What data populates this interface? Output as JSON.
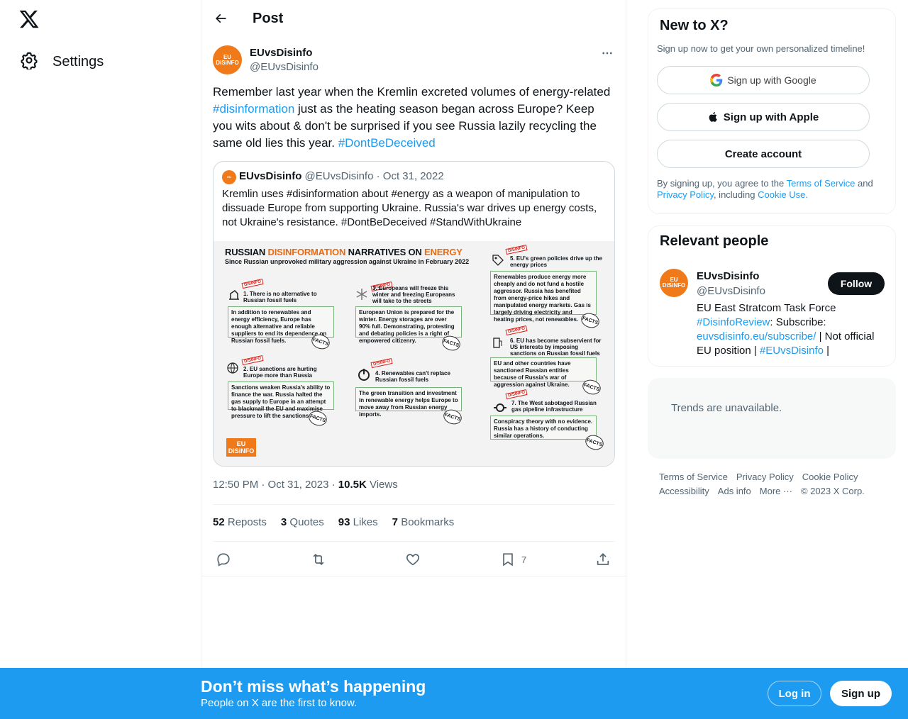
{
  "nav": {
    "settings_label": "Settings"
  },
  "header": {
    "title": "Post"
  },
  "tweet": {
    "author_name": "EUvsDisinfo",
    "author_handle": "@EUvsDisinfo",
    "text_part1": "Remember last year when the Kremlin excreted volumes of energy-related ",
    "hashtag1": "#disinformation",
    "text_part2": " just as the heating season began across Europe? Keep you wits about & don't be surprised if you see Russia lazily recycling the same old lies this year. ",
    "hashtag2": "#DontBeDeceived",
    "time": "12:50 PM · Oct 31, 2023 · ",
    "views_count": "10.5K",
    "views_label": " Views",
    "stats": {
      "reposts_n": "52",
      "reposts_l": "Reposts",
      "quotes_n": "3",
      "quotes_l": "Quotes",
      "likes_n": "93",
      "likes_l": "Likes",
      "bookmarks_n": "7",
      "bookmarks_l": "Bookmarks"
    },
    "bookmark_count": "7"
  },
  "quote": {
    "name": "EUvsDisinfo",
    "meta": "@EUvsDisinfo · Oct 31, 2022",
    "text": "Kremlin uses #disinformation about #energy as a weapon of manipulation to dissuade Europe from supporting Ukraine. Russia's war drives up energy costs, not Ukraine's resistance. #DontBeDeceived #StandWithUkraine"
  },
  "infographic": {
    "title_a": "RUSSIAN ",
    "title_b": "DISINFORMATION",
    "title_c": " NARRATIVES ON ",
    "title_d": "ENERGY",
    "subtitle": "Since Russian unprovoked military aggression against Ukraine in February 2022",
    "disinfo_tag": "DISINFO",
    "facts_tag": "FACTS",
    "claims": [
      "1. There is no alternative to Russian fossil fuels",
      "2. EU sanctions are hurting Europe more than Russia",
      "3. Europeans will freeze this winter and freezing Europeans will take to the streets",
      "4. Renewables can't replace Russian fossil fuels",
      "5. EU's green policies drive up the energy prices",
      "6. EU has become subservient for US interests by imposing sanctions on Russian fossil fuels",
      "7. The West sabotaged Russian gas pipeline infrastructure"
    ],
    "facts": [
      "In addition to renewables and energy efficiency, Europe has enough alternative and reliable suppliers to end its dependence on Russian fossil fuels.",
      "Sanctions weaken Russia's ability to finance the war. Russia halted the gas supply to Europe in an attempt to blackmail the EU and maximise pressure to lift the sanctions.",
      "European Union is prepared for the winter. Energy storages are over 90% full. Demonstrating, protesting and debating policies is a right of empowered citizenry.",
      "The green transition and investment in renewable energy helps Europe to move away from Russian energy imports.",
      "Renewables produce energy more cheaply and do not fund a hostile aggressor. Russia has benefited from energy-price hikes and manipulated energy markets. Gas is largely driving electricity and heating prices, not renewables.",
      "EU and other countries have sanctioned Russian entities because of Russia's war of aggression against Ukraine.",
      "Conspiracy theory with no evidence. Russia has a history of conducting similar operations."
    ],
    "logo_line1": "EU",
    "logo_line2": "vs",
    "logo_line3": "DiSiNFO"
  },
  "signup": {
    "title": "New to X?",
    "subtitle": "Sign up now to get your own personalized timeline!",
    "google": "Sign up with Google",
    "apple": "Sign up with Apple",
    "create": "Create account",
    "legal_1": "By signing up, you agree to the ",
    "tos": "Terms of Service",
    "legal_2": " and ",
    "privacy": "Privacy Policy",
    "legal_3": ", including ",
    "cookie": "Cookie Use."
  },
  "relevant": {
    "title": "Relevant people",
    "name": "EUvsDisinfo",
    "handle": "@EUvsDisinfo",
    "follow": "Follow",
    "bio_1": "EU East Stratcom Task Force ",
    "bio_tag1": "#DisinfoReview",
    "bio_2": ": Subscribe: ",
    "bio_link": "euvsdisinfo.eu/subscribe/",
    "bio_3": " | Not official EU position | ",
    "bio_tag2": "#EUvsDisinfo",
    "bio_4": " |"
  },
  "trends": {
    "text": "Trends are unavailable."
  },
  "footer": {
    "terms": "Terms of Service",
    "privacy": "Privacy Policy",
    "cookie": "Cookie Policy",
    "accessibility": "Accessibility",
    "ads": "Ads info",
    "more": "More ···",
    "copyright": "© 2023 X Corp."
  },
  "bottom": {
    "title": "Don’t miss what’s happening",
    "subtitle": "People on X are the first to know.",
    "login": "Log in",
    "signup": "Sign up"
  },
  "colors": {
    "accent": "#1d9bf0",
    "brand_orange": "#f07a1a"
  }
}
